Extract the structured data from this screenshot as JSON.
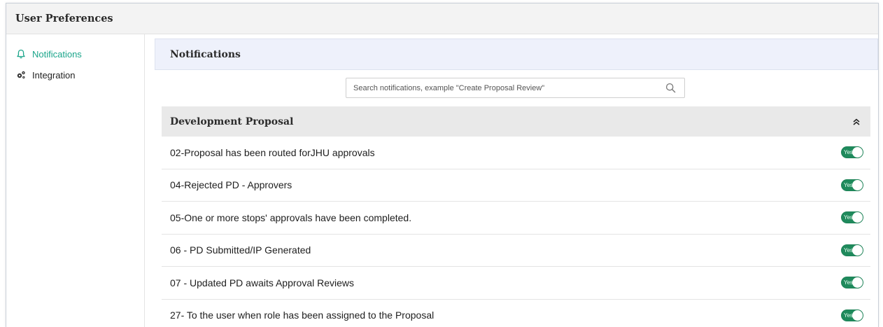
{
  "header": {
    "title": "User Preferences"
  },
  "sidebar": {
    "items": [
      {
        "label": "Notifications",
        "icon": "bell-icon",
        "active": true
      },
      {
        "label": "Integration",
        "icon": "gears-icon",
        "active": false
      }
    ]
  },
  "main": {
    "panel_title": "Notifications",
    "search": {
      "placeholder": "Search notifications, example \"Create Proposal Review\"",
      "value": ""
    },
    "section": {
      "title": "Development Proposal",
      "collapsed": false,
      "rows": [
        {
          "label": "02-Proposal has been routed forJHU approvals",
          "toggle": "Yes"
        },
        {
          "label": "04-Rejected PD - Approvers",
          "toggle": "Yes"
        },
        {
          "label": "05-One or more stops' approvals have been completed.",
          "toggle": "Yes"
        },
        {
          "label": "06 - PD Submitted/IP Generated",
          "toggle": "Yes"
        },
        {
          "label": "07 - Updated PD awaits Approval Reviews",
          "toggle": "Yes"
        },
        {
          "label": "27- To the user when role has been assigned to the Proposal",
          "toggle": "Yes"
        }
      ]
    }
  },
  "colors": {
    "accent": "#1aa58a",
    "toggle_on": "#1f8a5c",
    "panel_header_bg": "#eef1fb"
  }
}
